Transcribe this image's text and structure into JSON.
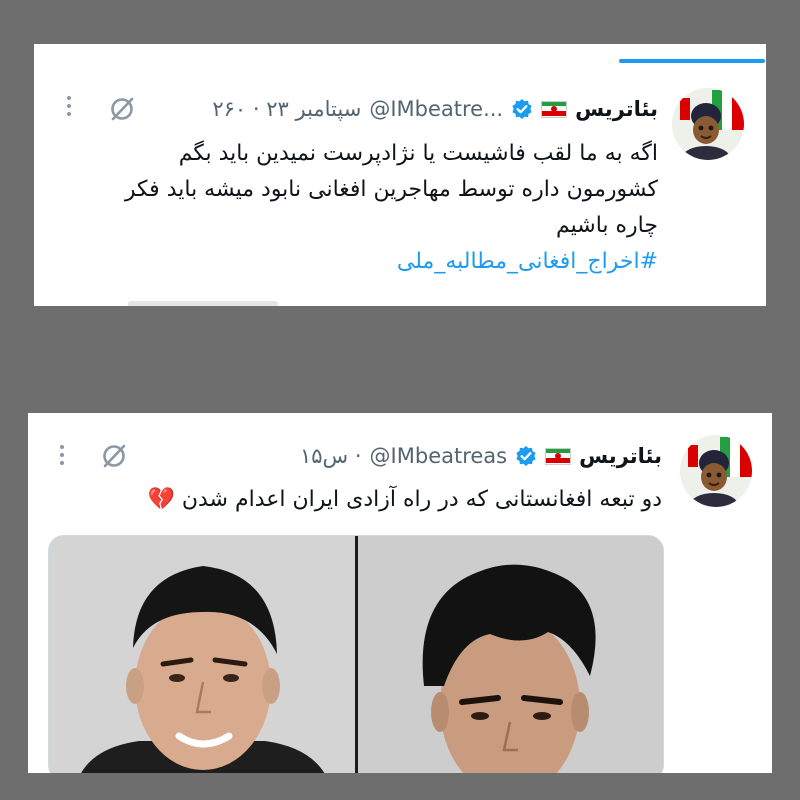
{
  "tweets": [
    {
      "display_name": "بئاتریس",
      "handle": "@IMbeatre...",
      "time": "۲۶۰ · ۲۳ سپتامبر",
      "flag_icon": "iran-flag-icon",
      "verified_icon": "verified-badge-icon",
      "lines": [
        "اگه به ما لقب فاشیست یا نژادپرست نمیدین باید بگم",
        "کشورمون داره توسط مهاجرین افغانی نابود میشه باید فکر",
        "چاره باشیم"
      ],
      "hashtag": "#اخراج_افغانی_مطالبه_ملی"
    },
    {
      "display_name": "بئاتریس",
      "handle": "@IMbeatreas",
      "time": "۱۵س ·",
      "flag_icon": "iran-flag-icon",
      "verified_icon": "verified-badge-icon",
      "text": "دو تبعه افغانستانی که در راه آزادی ایران اعدام شدن 💔"
    }
  ],
  "colors": {
    "accent": "#1d9bf0",
    "text": "#0f1419",
    "muted": "#536471",
    "backdrop": "#6e6e6e"
  }
}
